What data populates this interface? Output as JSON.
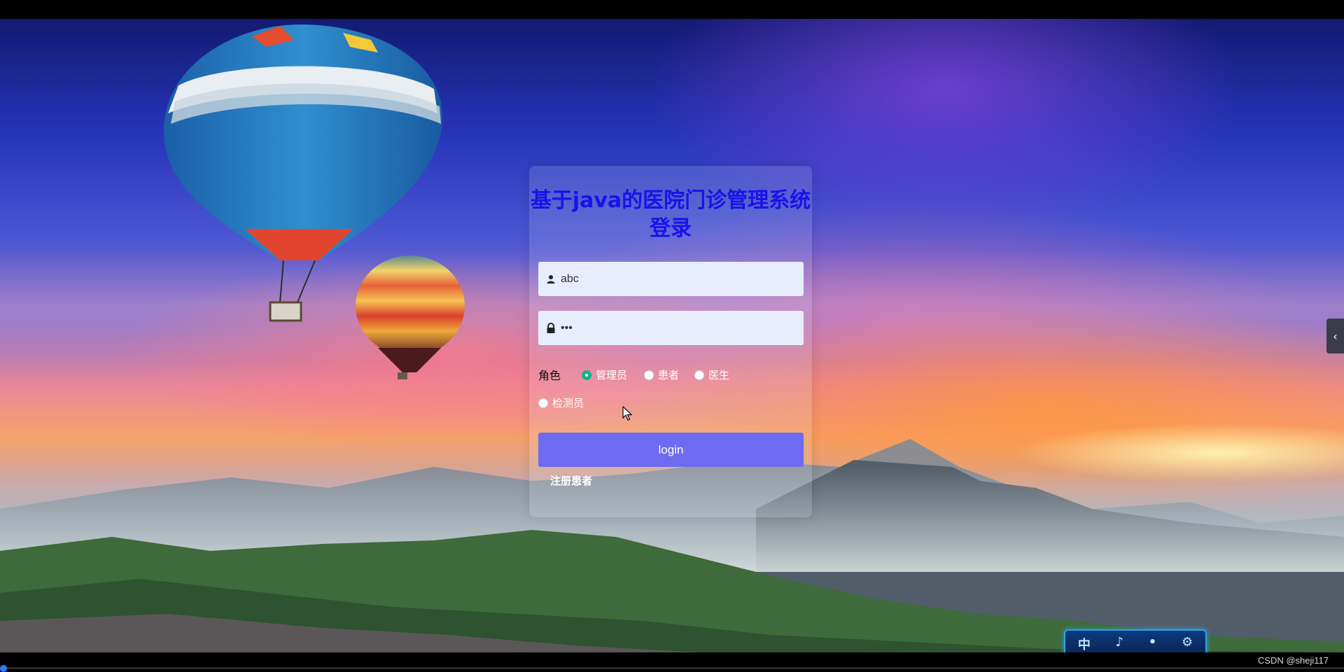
{
  "login": {
    "title": "基于java的医院门诊管理系统登录",
    "username": {
      "value": "abc"
    },
    "password": {
      "value": "abc"
    },
    "role_label": "角色",
    "roles": [
      {
        "label": "管理员",
        "checked": true
      },
      {
        "label": "患者",
        "checked": false
      },
      {
        "label": "医生",
        "checked": false
      },
      {
        "label": "检测员",
        "checked": false
      }
    ],
    "login_button": "login",
    "register_link": "注册患者"
  },
  "side_tab": {
    "icon": "chevron-left-icon",
    "glyph": "‹"
  },
  "tool_widget": {
    "items": [
      "中",
      "♪",
      "•",
      "⚙"
    ]
  },
  "watermark": "CSDN @sheji117",
  "colors": {
    "title": "#1a12e8",
    "button": "#6d6cf0",
    "radio_checked": "#15b38a",
    "field_bg": "#e8edfd"
  }
}
